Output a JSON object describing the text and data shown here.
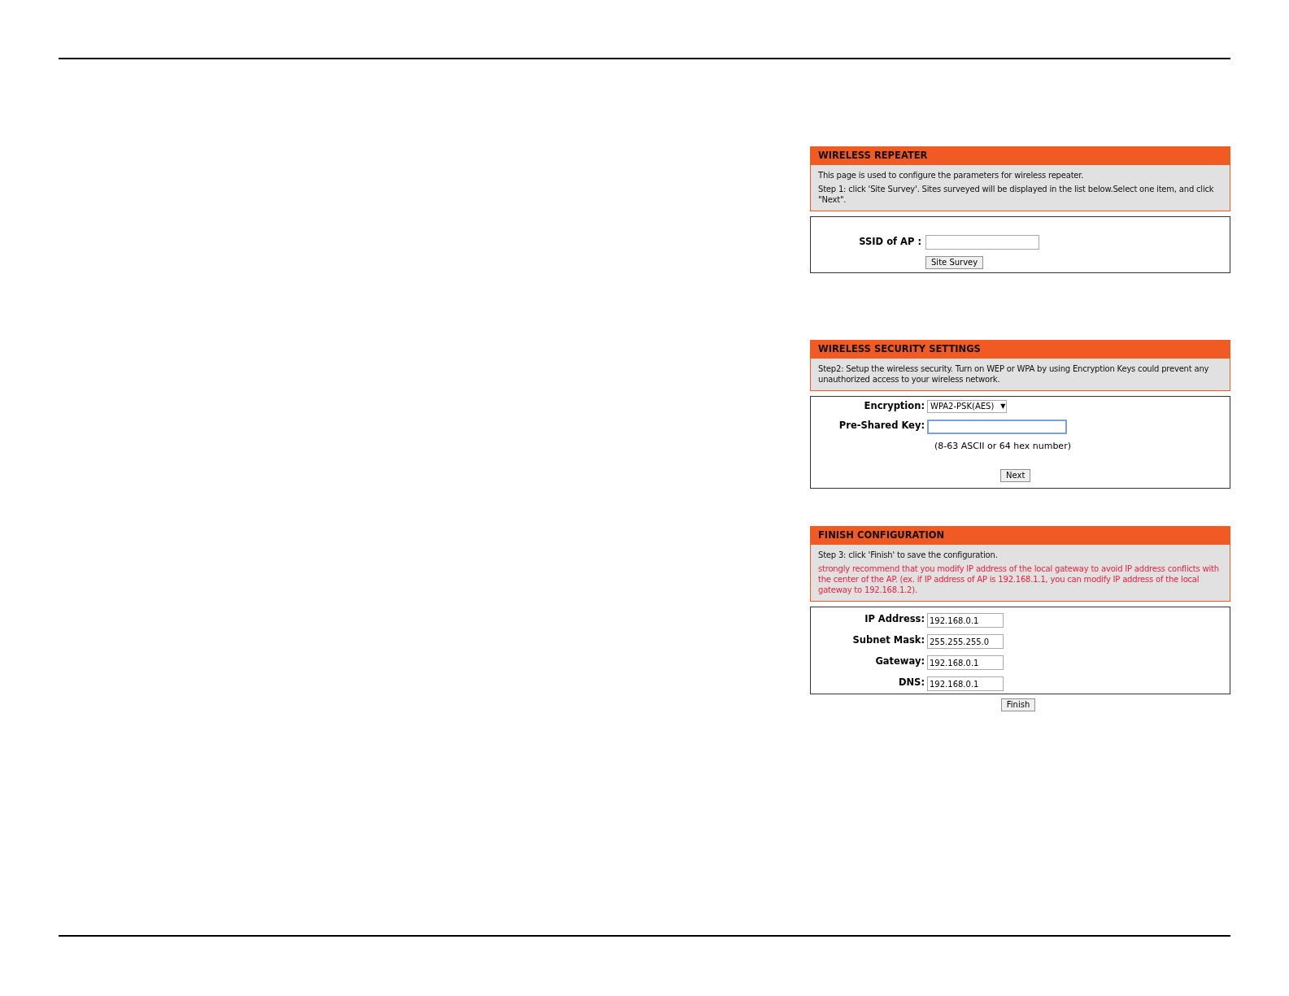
{
  "panels": [
    {
      "kind": "survey",
      "title": "WIRELESS REPEATER",
      "description": [
        {
          "kind": "note",
          "text": "This page is used to configure the parameters for wireless repeater."
        },
        {
          "kind": "note",
          "text": "Step 1: click 'Site Survey'. Sites surveyed will be displayed in the list below.Select one item, and click \"Next\"."
        }
      ],
      "fields": [
        {
          "kind": "text",
          "label": "SSID of AP :",
          "focused": false
        }
      ],
      "button": "Site Survey"
    },
    {
      "kind": "security",
      "title": "WIRELESS SECURITY SETTINGS",
      "description": [
        {
          "kind": "note",
          "text": "Step2: Setup the wireless security. Turn on WEP or WPA by using Encryption Keys could prevent any unauthorized access to your wireless network."
        }
      ],
      "fields": [
        {
          "kind": "select",
          "label": "Encryption:",
          "value": "WPA2-PSK(AES)",
          "arrow": "▼",
          "focused": false
        },
        {
          "kind": "text",
          "label": "Pre-Shared Key:",
          "focused": true
        }
      ],
      "hint": "(8-63 ASCII or 64 hex number)",
      "button": "Next"
    },
    {
      "kind": "finish",
      "title": "FINISH CONFIGURATION",
      "description": [
        {
          "kind": "note",
          "text": "Step 3: click 'Finish' to save the configuration."
        },
        {
          "kind": "warning",
          "text": "strongly recommend that you modify IP address of the local gateway to avoid IP address conflicts with the center of the AP. (ex. if IP address of AP is 192.168.1.1, you can modify IP address of the local gateway to 192.168.1.2)."
        }
      ],
      "fields": [
        {
          "kind": "text",
          "label": "IP Address:",
          "value": "192.168.0.1",
          "focused": false
        },
        {
          "kind": "text",
          "label": "Subnet Mask:",
          "value": "255.255.255.0",
          "focused": false
        },
        {
          "kind": "text",
          "label": "Gateway:",
          "value": "192.168.0.1",
          "focused": false
        },
        {
          "kind": "text",
          "label": "DNS:",
          "value": "192.168.0.1",
          "focused": false
        }
      ],
      "button": "Finish"
    }
  ]
}
